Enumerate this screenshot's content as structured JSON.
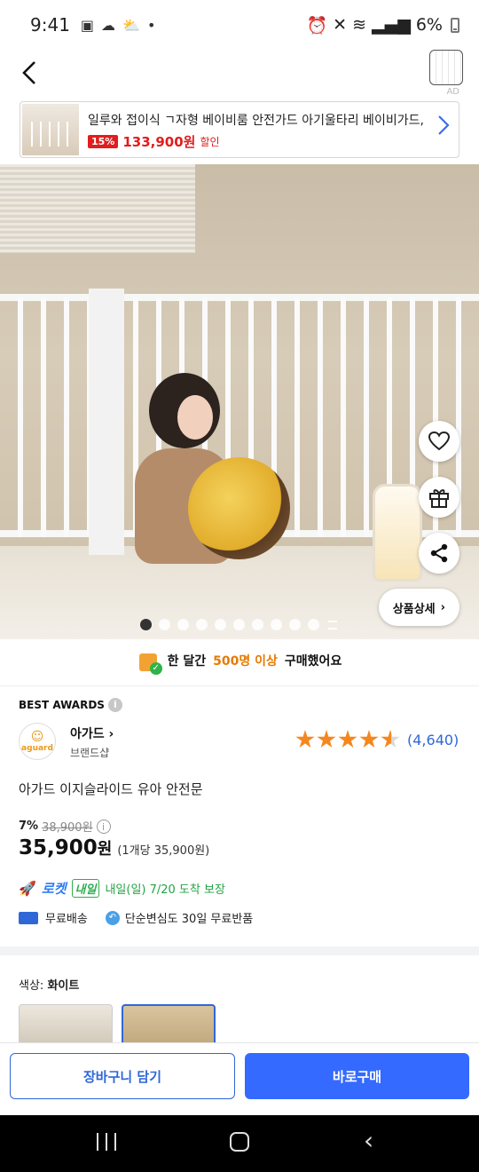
{
  "status_bar": {
    "time": "9:41",
    "battery": "6%"
  },
  "ad_banner": {
    "title": "일루와 접이식 ㄱ자형 베이비룸 안전가드 아기울타리 베이비가드, ...",
    "discount": "15%",
    "price": "133,900원",
    "sale_label": "할인",
    "ad_mark": "AD"
  },
  "hero": {
    "detail_button": "상품상세",
    "page_count": 11,
    "active_page": 1
  },
  "purchase_info": {
    "prefix": "한 달간",
    "highlight": "500명 이상",
    "suffix": "구매했어요"
  },
  "product": {
    "best_awards": "BEST AWARDS",
    "brand_logo_text": "aguard",
    "brand_name": "아가드",
    "brand_sub": "브랜드샵",
    "rating": 4.5,
    "review_count": "(4,640)",
    "title": "아가드 이지슬라이드 유아 안전문",
    "discount_rate": "7%",
    "original_price": "38,900원",
    "price_number": "35,900",
    "price_unit": "원",
    "unit_price": "(1개당 35,900원)"
  },
  "delivery": {
    "rocket_label": "로켓",
    "naeil_badge": "내일",
    "arrival": "내일(일) 7/20 도착 보장",
    "free_shipping": "무료배송",
    "free_return": "단순변심도 30일 무료반품"
  },
  "options": {
    "color_label": "색상:",
    "color_value": "화이트"
  },
  "actions": {
    "cart": "장바구니 담기",
    "buy": "바로구매"
  },
  "colors": {
    "accent": "#346aff",
    "sale_red": "#e11d1d",
    "rocket_green": "#23a343",
    "star": "#f5871f"
  }
}
